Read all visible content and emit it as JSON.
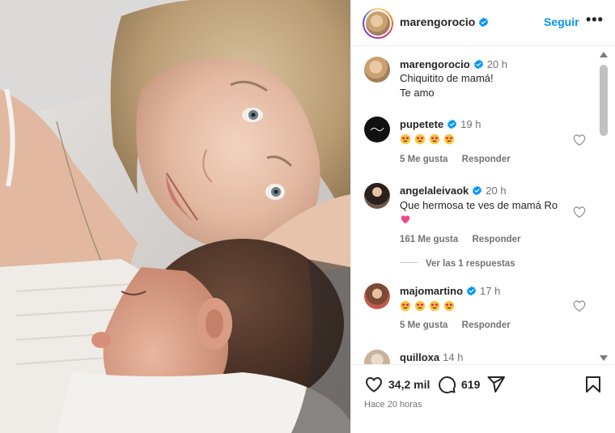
{
  "post": {
    "author": "marengorocio",
    "verified": true,
    "follow_label": "Seguir",
    "more_label": "•••",
    "caption": {
      "username": "marengorocio",
      "time": "20 h",
      "line1": "Chiquitito de mamá!",
      "line2": "Te amo"
    },
    "comments": [
      {
        "username": "pupetete",
        "time": "19 h",
        "emojis": [
          "heart-eyes",
          "heart-eyes",
          "heart-eyes",
          "heart-eyes"
        ],
        "likes": "5 Me gusta",
        "reply": "Responder"
      },
      {
        "username": "angelaleivaok",
        "time": "20 h",
        "text": "Que hermosa te ves de mamá Ro",
        "emojis": [
          "pink-heart"
        ],
        "likes": "161 Me gusta",
        "reply": "Responder",
        "view_replies": "Ver las 1 respuestas"
      },
      {
        "username": "majomartino",
        "time": "17 h",
        "emojis": [
          "heart-eyes",
          "heart-eyes",
          "heart-eyes",
          "heart-eyes"
        ],
        "likes": "5 Me gusta",
        "reply": "Responder"
      },
      {
        "username": "quilloxa",
        "time": "14 h"
      }
    ],
    "footer": {
      "like_count": "34,2 mil",
      "comment_count": "619",
      "posted_ago": "Hace 20 horas"
    },
    "icons": {
      "like": "heart-outline-icon",
      "comment": "comment-bubble-icon",
      "share": "paper-plane-icon",
      "save": "bookmark-icon"
    },
    "colors": {
      "link": "#0095f6",
      "verified": "#0095f6",
      "secondary_text": "#737373",
      "primary_text": "#262626"
    }
  }
}
